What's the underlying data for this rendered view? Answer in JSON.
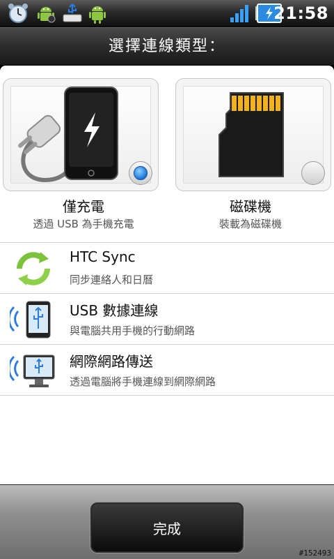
{
  "statusbar": {
    "icons": [
      "alarm-clock-icon",
      "android-debug-icon",
      "usb-storage-icon",
      "android-icon",
      "signal-bars-icon",
      "battery-charging-icon"
    ],
    "time": "21:58"
  },
  "title": "選擇連線類型：",
  "options": [
    {
      "title": "僅充電",
      "subtitle": "透過 USB 為手機充電",
      "icon": "phone-charging-icon",
      "selected": true
    },
    {
      "title": "磁碟機",
      "subtitle": "裝載為磁碟機",
      "icon": "sd-card-icon",
      "selected": false
    }
  ],
  "list": [
    {
      "title": "HTC Sync",
      "subtitle": "同步連絡人和日曆",
      "icon": "sync-arrows-icon"
    },
    {
      "title": "USB 數據連線",
      "subtitle": "與電腦共用手機的行動網路",
      "icon": "usb-tethering-icon"
    },
    {
      "title": "網際網路傳送",
      "subtitle": "透過電腦將手機連線到網際網路",
      "icon": "internet-pass-through-icon"
    }
  ],
  "done_label": "完成",
  "watermark": "#152493"
}
